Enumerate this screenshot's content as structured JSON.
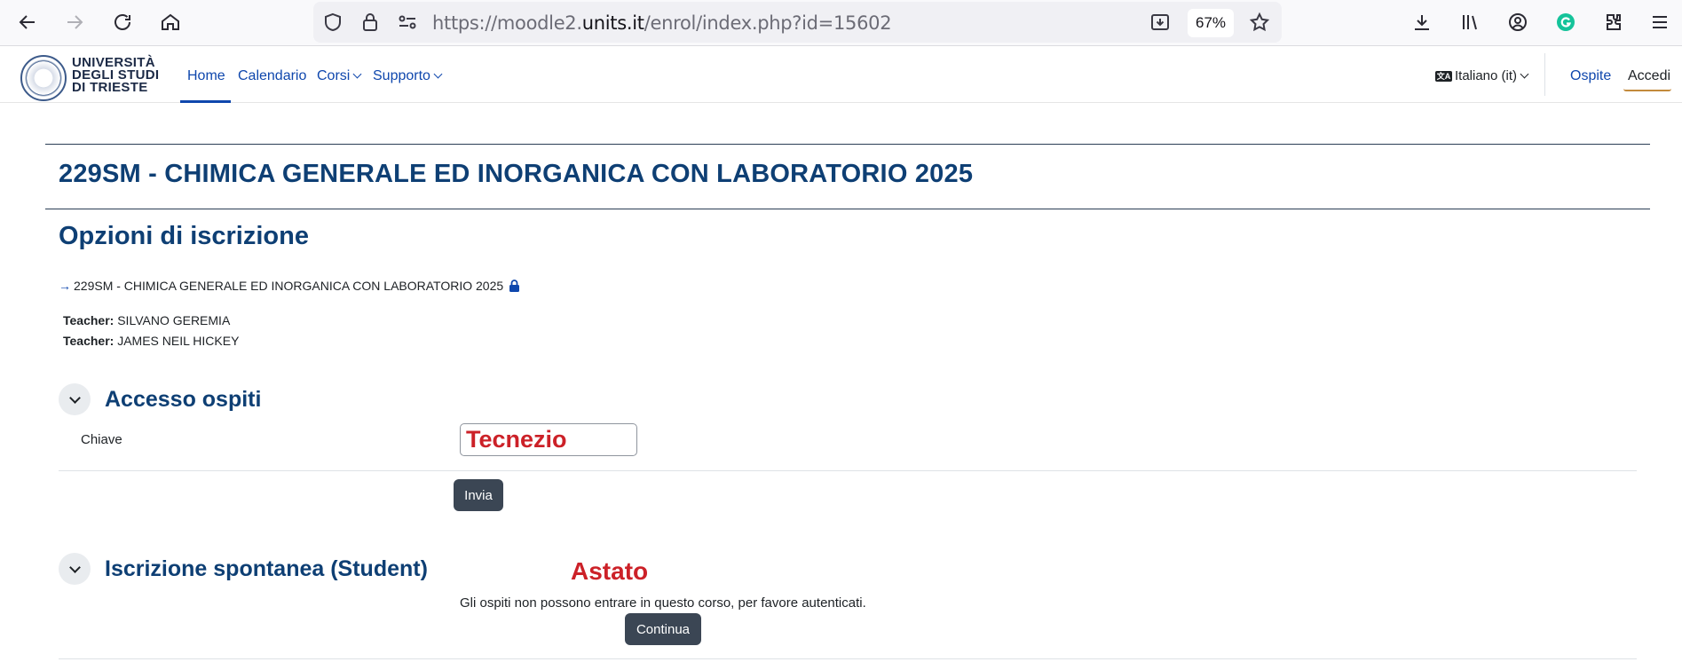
{
  "browser": {
    "url_prefix": "https://moodle2.",
    "url_domain": "units.it",
    "url_path": "/enrol/index.php?id=15602",
    "zoom": "67%"
  },
  "navbar": {
    "logo_line1": "UNIVERSITÀ",
    "logo_line2": "DEGLI STUDI",
    "logo_line3": "DI TRIESTE",
    "home": "Home",
    "calendar": "Calendario",
    "courses": "Corsi",
    "support": "Supporto",
    "language": "Italiano (it)",
    "language_icon": "文A",
    "guest": "Ospite",
    "login": "Accedi"
  },
  "page": {
    "course_title": "229SM - CHIMICA GENERALE ED INORGANICA CON LABORATORIO 2025",
    "enrol_heading": "Opzioni di iscrizione",
    "course_link_arrow": "→",
    "course_link": "229SM - CHIMICA GENERALE ED INORGANICA CON LABORATORIO 2025",
    "teachers": [
      {
        "role": "Teacher:",
        "name": "SILVANO GEREMIA"
      },
      {
        "role": "Teacher:",
        "name": "JAMES NEIL HICKEY"
      }
    ]
  },
  "guest_access": {
    "title": "Accesso ospiti",
    "key_label": "Chiave",
    "key_value": "Tecnezio",
    "submit": "Invia"
  },
  "self_enrol": {
    "title": "Iscrizione spontanea (Student)",
    "annotation": "Astato",
    "message": "Gli ospiti non possono entrare in questo corso, per favore autenticati.",
    "continue": "Continua"
  },
  "colors": {
    "heading": "#0e3f74",
    "link": "#0f47ad",
    "annotation_red": "#cc2128",
    "button_dark": "#3b4654"
  }
}
